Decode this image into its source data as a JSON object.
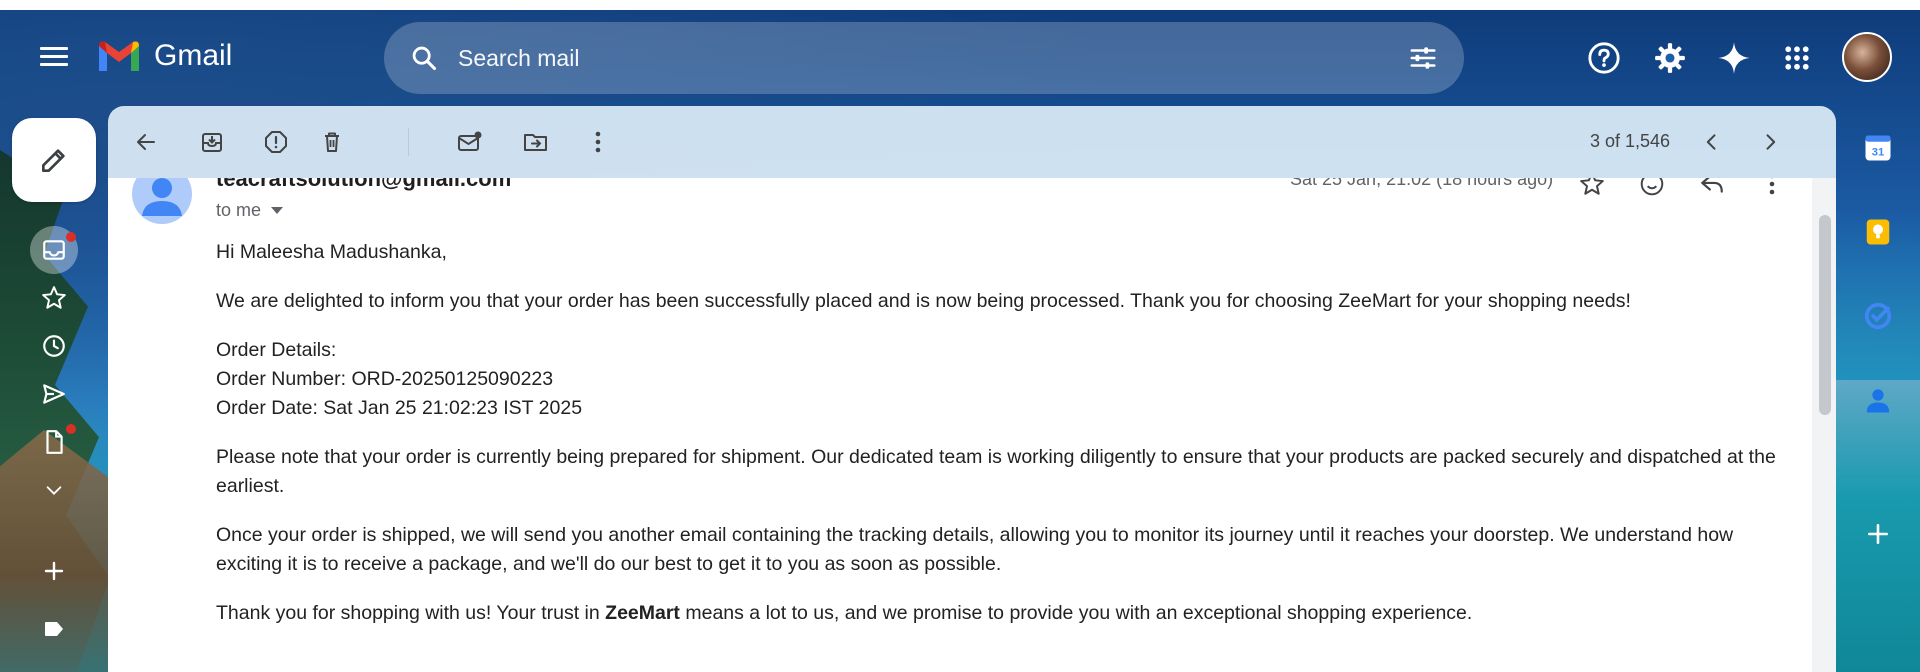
{
  "app": {
    "name": "Gmail"
  },
  "search": {
    "placeholder": "Search mail"
  },
  "toolbar": {
    "pager": "3 of 1,546"
  },
  "email": {
    "sender": "teacraftsolution@gmail.com",
    "date": "Sat 25 Jan, 21:02 (18 hours ago)",
    "recipient": "to me",
    "greeting": "Hi Maleesha Madushanka,",
    "intro": "We are delighted to inform you that your order has been successfully placed and is now being processed. Thank you for choosing ZeeMart for your shopping needs!",
    "order_heading": "Order Details:",
    "order_number": "Order Number: ORD-20250125090223",
    "order_date": "Order Date: Sat Jan 25 21:02:23 IST 2025",
    "para_shipment": "Please note that your order is currently being prepared for shipment. Our dedicated team is working diligently to ensure that your products are packed securely and dispatched at the earliest.",
    "para_tracking": "Once your order is shipped, we will send you another email containing the tracking details, allowing you to monitor its journey until it reaches your doorstep. We understand how exciting it is to receive a package, and we'll do our best to get it to you as soon as possible.",
    "closing_before": "Thank you for shopping with us! Your trust in ",
    "closing_brand": "ZeeMart",
    "closing_after": " means a lot to us, and we promise to provide you with an exceptional shopping experience."
  },
  "right_apps": {
    "calendar_day": "31"
  },
  "colors": {
    "accent_red": "#d93025",
    "gmail_blue": "#4285f4",
    "keep_yellow": "#fbbc04"
  }
}
